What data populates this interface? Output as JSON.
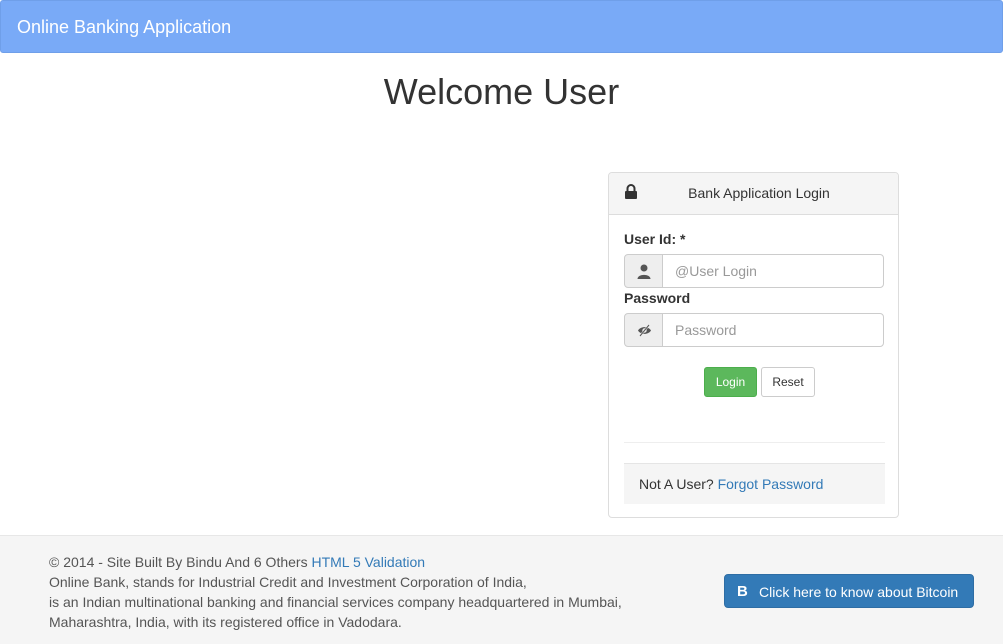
{
  "navbar": {
    "brand": "Online Banking Application"
  },
  "main": {
    "welcome": "Welcome User"
  },
  "login_panel": {
    "title": "Bank Application Login",
    "icons": {
      "heading": "lock-icon",
      "user": "user-icon",
      "password": "eye-slash-icon"
    },
    "user_id": {
      "label": "User Id: *",
      "placeholder": "@User Login",
      "value": ""
    },
    "password": {
      "label": "Password",
      "placeholder": "Password",
      "value": ""
    },
    "buttons": {
      "login": "Login",
      "reset": "Reset"
    },
    "footer": {
      "prefix": "Not A User?",
      "forgot_link": "Forgot Password"
    }
  },
  "page_footer": {
    "copyright": "© 2014 - Site Built By Bindu And 6 Others",
    "validation_link": "HTML 5 Validation",
    "lines": [
      "Online Bank, stands for Industrial Credit and Investment Corporation of India,",
      "is an Indian multinational banking and financial services company headquartered in Mumbai,",
      "Maharashtra, India, with its registered office in Vadodara."
    ],
    "bitcoin_button": {
      "icon": "B",
      "label": "Click here to know about Bitcoin"
    }
  },
  "colors": {
    "navbar": "#79aaf7",
    "login_button": "#5cb85c",
    "link": "#337ab7",
    "bitcoin_button": "#337ab7"
  }
}
